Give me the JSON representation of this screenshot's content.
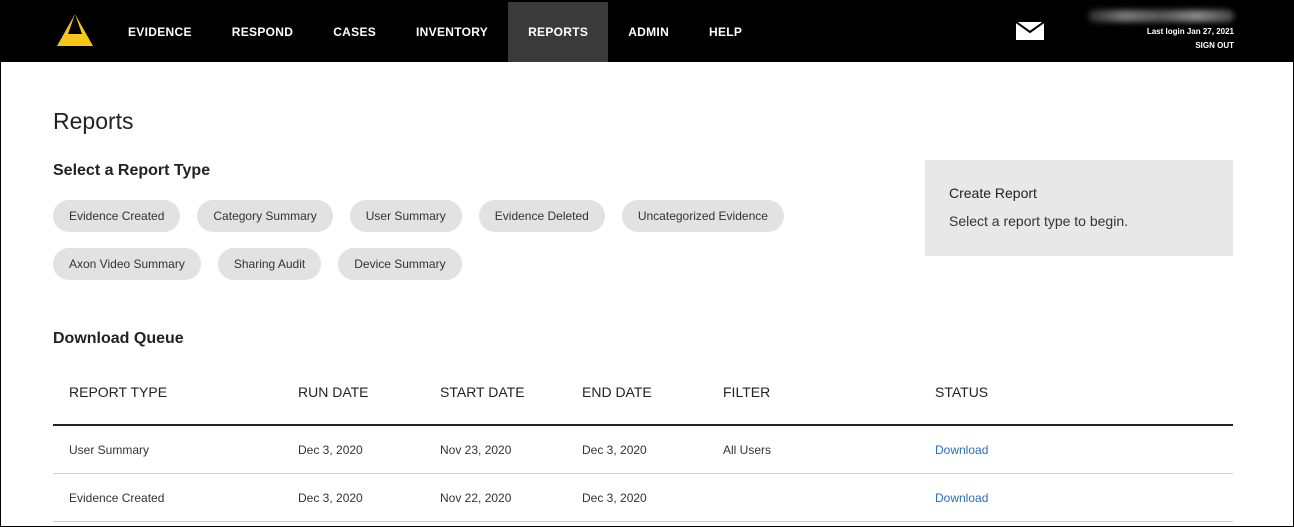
{
  "header": {
    "nav": [
      {
        "label": "EVIDENCE",
        "active": false
      },
      {
        "label": "RESPOND",
        "active": false
      },
      {
        "label": "CASES",
        "active": false
      },
      {
        "label": "INVENTORY",
        "active": false
      },
      {
        "label": "REPORTS",
        "active": true
      },
      {
        "label": "ADMIN",
        "active": false
      },
      {
        "label": "HELP",
        "active": false
      }
    ],
    "mail_icon": "envelope-icon",
    "logo_icon": "axon-delta-logo",
    "last_login": "Last login Jan 27, 2021",
    "sign_out": "SIGN OUT",
    "accent_color": "#f5c518"
  },
  "main": {
    "title": "Reports",
    "report_type_heading": "Select a Report Type",
    "report_types_row1": [
      "Evidence Created",
      "Category Summary",
      "User Summary",
      "Evidence Deleted",
      "Uncategorized Evidence"
    ],
    "report_types_row2": [
      "Axon Video Summary",
      "Sharing Audit",
      "Device Summary"
    ],
    "create_report": {
      "title": "Create Report",
      "hint": "Select a report type to begin."
    },
    "queue_heading": "Download Queue",
    "queue_columns": [
      "REPORT TYPE",
      "RUN DATE",
      "START DATE",
      "END DATE",
      "FILTER",
      "STATUS"
    ],
    "queue_rows": [
      {
        "type": "User Summary",
        "run": "Dec 3, 2020",
        "start": "Nov 23, 2020",
        "end": "Dec 3, 2020",
        "filter": "All Users",
        "status": "Download"
      },
      {
        "type": "Evidence Created",
        "run": "Dec 3, 2020",
        "start": "Nov 22, 2020",
        "end": "Dec 3, 2020",
        "filter": "",
        "status": "Download"
      }
    ],
    "link_color": "#2a6ebb"
  }
}
